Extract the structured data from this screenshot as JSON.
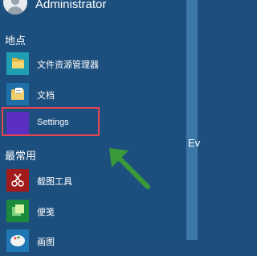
{
  "user": {
    "name": "Administrator",
    "avatar_icon": "user-avatar-icon"
  },
  "sections": {
    "places_label": "地点",
    "most_used_label": "最常用"
  },
  "places": [
    {
      "label": "文件资源管理器",
      "icon": "file-explorer-icon",
      "tile_color": "#1f9fb1"
    },
    {
      "label": "文档",
      "icon": "documents-icon",
      "tile_color": "#1f6fa8"
    },
    {
      "label": "Settings",
      "icon": "settings-icon",
      "tile_color": "#5b2fbf"
    }
  ],
  "most_used": [
    {
      "label": "截图工具",
      "icon": "snipping-tool-icon",
      "tile_color": "#a21b1b"
    },
    {
      "label": "便笺",
      "icon": "sticky-notes-icon",
      "tile_color": "#1a8a3d"
    },
    {
      "label": "画图",
      "icon": "paint-icon",
      "tile_color": "#1f78b4"
    }
  ],
  "right_pane_text": "Ev",
  "annotation": {
    "highlight_color": "#e84551",
    "arrow_color": "#3a9a3a"
  }
}
